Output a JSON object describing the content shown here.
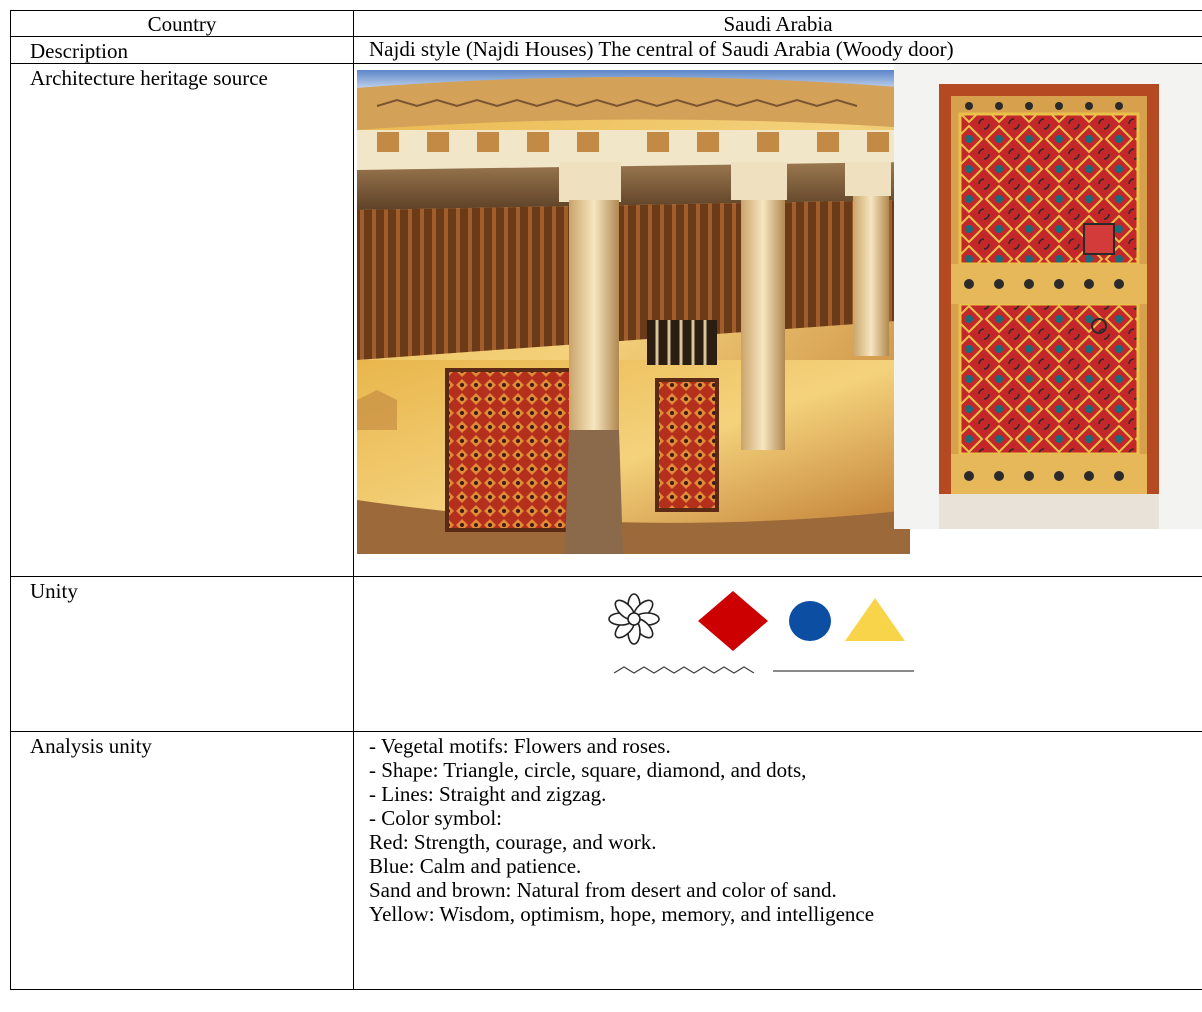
{
  "table": {
    "header": {
      "label": "Country",
      "value": "Saudi Arabia"
    },
    "description": {
      "label": "Description",
      "value": "Najdi style (Najdi Houses) The central of Saudi Arabia (Woody door)"
    },
    "source": {
      "label": "Architecture heritage source"
    },
    "unity": {
      "label": "Unity"
    },
    "analysis": {
      "label": "Analysis unity",
      "lines": [
        "- Vegetal motifs: Flowers and roses.",
        "- Shape: Triangle, circle, square, diamond, and dots,",
        "- Lines: Straight and zigzag.",
        "- Color symbol:",
        "Red: Strength, courage, and work.",
        "Blue: Calm and patience.",
        "Sand and brown: Natural from desert and color of sand.",
        "Yellow: Wisdom, optimism, hope, memory, and intelligence"
      ]
    }
  },
  "unity_colors": {
    "diamond": "#cc0000",
    "circle": "#0b4ea2",
    "triangle": "#f7d44a"
  }
}
